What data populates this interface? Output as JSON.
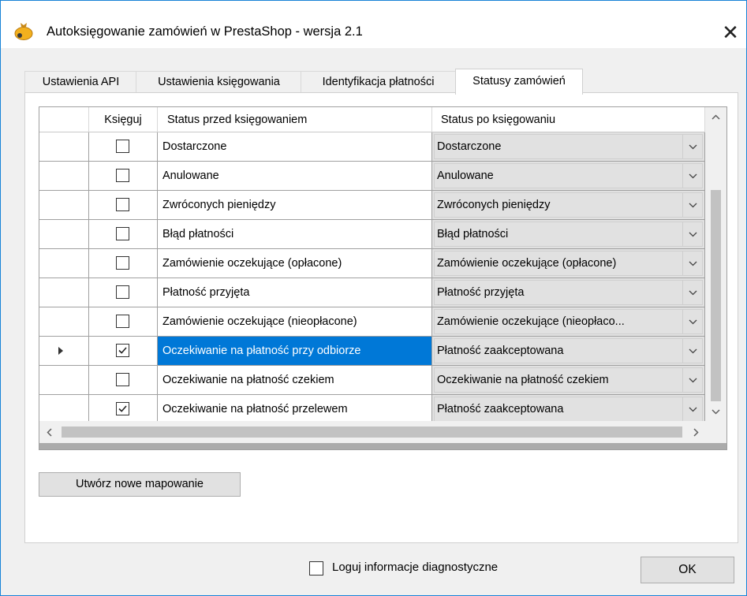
{
  "window": {
    "title": "Autoksięgowanie zamówień w PrestaShop - wersja 2.1",
    "close_glyph": "✕"
  },
  "tabs": [
    {
      "label": "Ustawienia API",
      "active": false
    },
    {
      "label": "Ustawienia księgowania",
      "active": false
    },
    {
      "label": "Identyfikacja płatności",
      "active": false
    },
    {
      "label": "Statusy zamówień",
      "active": true
    }
  ],
  "grid": {
    "headers": {
      "post": "Księguj",
      "before": "Status przed księgowaniem",
      "after": "Status po księgowaniu"
    },
    "rows": [
      {
        "post": false,
        "before": "Dostarczone",
        "after": "Dostarczone",
        "selected": false
      },
      {
        "post": false,
        "before": "Anulowane",
        "after": "Anulowane",
        "selected": false
      },
      {
        "post": false,
        "before": "Zwróconych pieniędzy",
        "after": "Zwróconych pieniędzy",
        "selected": false
      },
      {
        "post": false,
        "before": "Błąd płatności",
        "after": "Błąd płatności",
        "selected": false
      },
      {
        "post": false,
        "before": "Zamówienie oczekujące (opłacone)",
        "after": "Zamówienie oczekujące (opłacone)",
        "selected": false
      },
      {
        "post": false,
        "before": "Płatność przyjęta",
        "after": "Płatność przyjęta",
        "selected": false
      },
      {
        "post": false,
        "before": "Zamówienie oczekujące (nieopłacone)",
        "after": "Zamówienie oczekujące (nieopłaco...",
        "selected": false
      },
      {
        "post": true,
        "before": "Oczekiwanie na płatność przy odbiorze",
        "after": "Płatność zaakceptowana",
        "selected": true
      },
      {
        "post": false,
        "before": "Oczekiwanie na płatność czekiem",
        "after": "Oczekiwanie na płatność czekiem",
        "selected": false
      },
      {
        "post": true,
        "before": "Oczekiwanie na płatność przelewem",
        "after": "Płatność zaakceptowana",
        "selected": false
      }
    ]
  },
  "buttons": {
    "new_mapping": "Utwórz nowe mapowanie",
    "ok": "OK"
  },
  "footer": {
    "log_label": "Loguj informacje diagnostyczne",
    "log_checked": false
  },
  "colors": {
    "selection": "#0078d7",
    "window_border": "#1883d7",
    "combo_bg": "#e1e1e1"
  }
}
